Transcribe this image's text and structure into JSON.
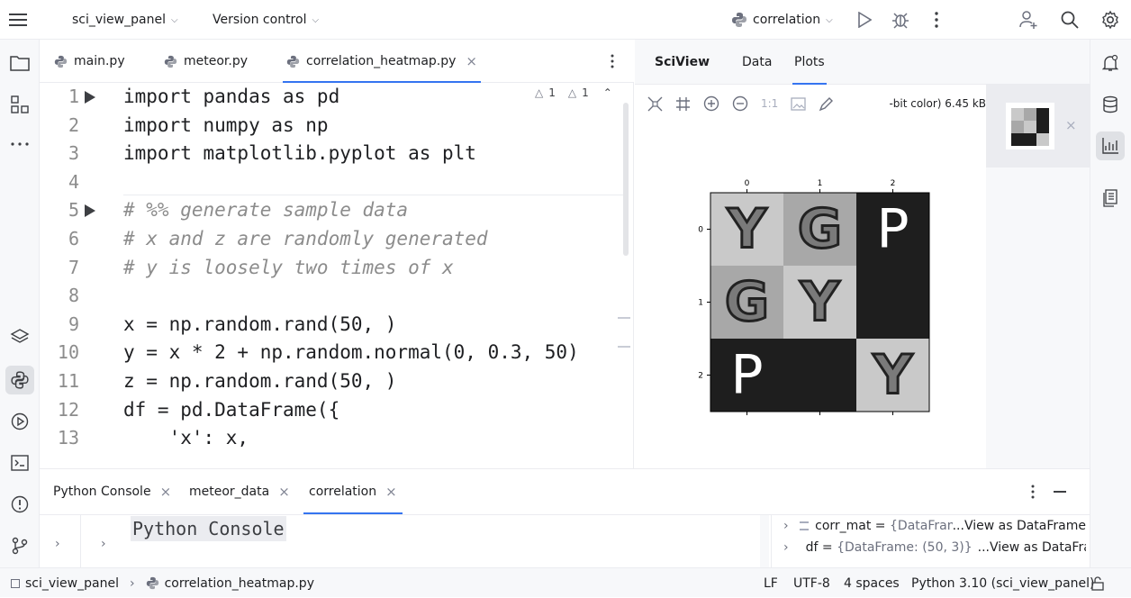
{
  "topbar": {
    "project": "sci_view_panel",
    "vcs": "Version control",
    "run_config": "correlation"
  },
  "editor": {
    "tabs": [
      {
        "label": "main.py"
      },
      {
        "label": "meteor.py"
      },
      {
        "label": "correlation_heatmap.py"
      }
    ],
    "warnings": "1",
    "weak_warnings": "1",
    "line_numbers": [
      "1",
      "2",
      "3",
      "4",
      "5",
      "6",
      "7",
      "8",
      "9",
      "10",
      "11",
      "12",
      "13"
    ],
    "lines": [
      "import pandas as pd",
      "import numpy as np",
      "import matplotlib.pyplot as plt",
      "",
      "# %% generate sample data",
      "# x and z are randomly generated",
      "# y is loosely two times of x",
      "",
      "x = np.random.rand(50, )",
      "y = x * 2 + np.random.normal(0, 0.3, 50)",
      "z = np.random.rand(50, )",
      "df = pd.DataFrame({",
      "    'x': x,"
    ]
  },
  "sciview": {
    "title": "SciView",
    "tabs": [
      "Data",
      "Plots"
    ],
    "zoom_label": "1:1",
    "image_info": "-bit color) 6.45 kB",
    "plot": {
      "ticks_x": [
        "0",
        "1",
        "2"
      ],
      "ticks_y": [
        "0",
        "1",
        "2"
      ],
      "cells": [
        [
          {
            "fill": "#c9c9c9",
            "letter": "Y"
          },
          {
            "fill": "#a8a8a8",
            "letter": "G"
          },
          {
            "fill": "#1e1e1e",
            "letter": "P"
          }
        ],
        [
          {
            "fill": "#a8a8a8",
            "letter": "G"
          },
          {
            "fill": "#c9c9c9",
            "letter": "Y"
          },
          {
            "fill": "#1e1e1e",
            "letter": ""
          }
        ],
        [
          {
            "fill": "#1e1e1e",
            "letter": "P"
          },
          {
            "fill": "#1e1e1e",
            "letter": ""
          },
          {
            "fill": "#c9c9c9",
            "letter": "Y"
          }
        ]
      ]
    }
  },
  "bottom": {
    "tabs": [
      "Python Console",
      "meteor_data",
      "correlation"
    ],
    "console_title": "Python Console",
    "vars": [
      {
        "name": "corr_mat",
        "value": "{DataFrame: (",
        "link": "...View as DataFrame"
      },
      {
        "name": "df",
        "value": "{DataFrame: (50, 3)}",
        "link": "...View as DataFrame"
      }
    ]
  },
  "status": {
    "project": "sci_view_panel",
    "file": "correlation_heatmap.py",
    "line_sep": "LF",
    "encoding": "UTF-8",
    "indent": "4 spaces",
    "interpreter": "Python 3.10 (sci_view_panel)"
  }
}
